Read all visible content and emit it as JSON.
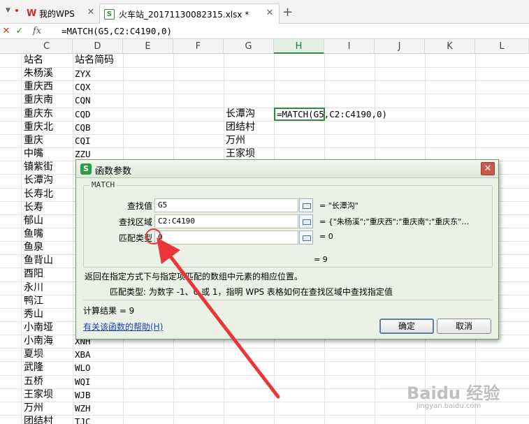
{
  "tabs": [
    {
      "label": "我的WPS"
    },
    {
      "label": "火车站_20171130082315.xlsx *"
    }
  ],
  "formula_bar": {
    "fx_label": "fx",
    "formula": "=MATCH(G5,C2:C4190,0)"
  },
  "columns": [
    "C",
    "D",
    "E",
    "F",
    "G",
    "H",
    "I",
    "J",
    "K",
    "L"
  ],
  "col_c": [
    "站名",
    "朱杨溪",
    "重庆西",
    "重庆南",
    "重庆东",
    "重庆北",
    "重庆",
    "中嘴",
    "镇紫街",
    "长潭沟",
    "长寿北",
    "长寿",
    "郁山",
    "鱼嘴",
    "鱼泉",
    "鱼背山",
    "酉阳",
    "永川",
    "鸭江",
    "秀山",
    "小南垭",
    "小南海",
    "夏坝",
    "武隆",
    "五桥",
    "王家坝",
    "万州",
    "团结村"
  ],
  "col_d": [
    "站名简码",
    "ZYX",
    "CQX",
    "CQN",
    "CQD",
    "CQB",
    "CQI",
    "ZZU",
    "",
    "",
    "",
    "",
    "",
    "",
    "",
    "",
    "",
    "",
    "",
    "",
    "",
    "XNH",
    "XBA",
    "WLO",
    "WQI",
    "WJB",
    "WZH",
    "TJC"
  ],
  "col_g": [
    "长潭沟",
    "团结村",
    "万州",
    "王家坝"
  ],
  "active_cell_formula": "=MATCH(G5,C2:C4190,0)",
  "dialog": {
    "title": "函数参数",
    "group_label": "MATCH",
    "params": [
      {
        "label": "查找值",
        "value": "G5",
        "result": "= \"长潭沟\""
      },
      {
        "label": "查找区域",
        "value": "C2:C4190",
        "result": "= {\"朱杨溪\";\"重庆西\";\"重庆南\";\"重庆东\"…"
      },
      {
        "label": "匹配类型",
        "value": "0",
        "result": "= 0"
      }
    ],
    "overall_result": "= 9",
    "description": "返回在指定方式下与指定项匹配的数组中元素的相应位置。",
    "hint": "匹配类型:  为数字 -1、0 或 1，指明 WPS 表格如何在查找区域中查找指定值",
    "calc_result": "计算结果 = 9",
    "help_link": "有关该函数的帮助(H)",
    "ok_label": "确定",
    "cancel_label": "取消"
  },
  "watermark": {
    "text": "Baidu 经验",
    "sub": "jingyan.baidu.com"
  },
  "colors": {
    "accent_green": "#2f8c3f",
    "annotation_red": "#e8373b",
    "close_red": "#c95a49"
  }
}
